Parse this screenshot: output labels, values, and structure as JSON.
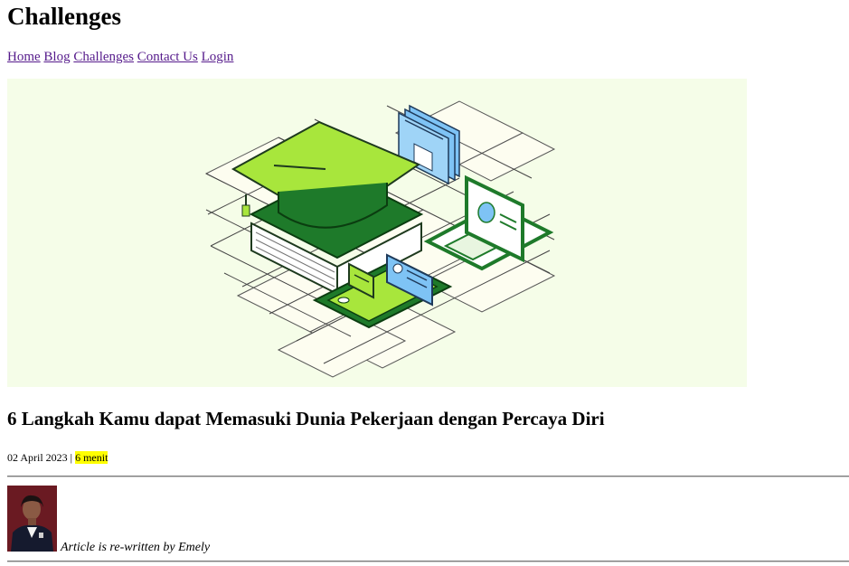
{
  "header": {
    "site_title": "Challenges"
  },
  "nav": {
    "items": [
      {
        "label": "Home"
      },
      {
        "label": "Blog"
      },
      {
        "label": "Challenges"
      },
      {
        "label": "Contact Us"
      },
      {
        "label": "Login"
      }
    ]
  },
  "hero": {
    "background": "#f5fde8",
    "accent_green": "#a8e63c",
    "dark_green": "#1e7a2a",
    "accent_blue": "#7ec3f5"
  },
  "article": {
    "title": "6 Langkah Kamu dapat Memasuki Dunia Pekerjaan dengan Percaya Diri",
    "date": "02 April 2023",
    "separator": "|",
    "read_time": "6 menit",
    "author_caption": "Article is re-written by Emely"
  }
}
